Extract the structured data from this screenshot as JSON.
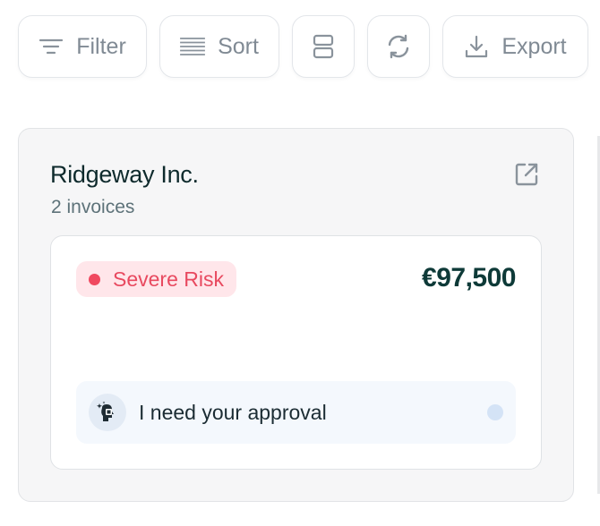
{
  "toolbar": {
    "filter_label": "Filter",
    "sort_label": "Sort",
    "export_label": "Export",
    "icons": [
      "filter-icon",
      "sort-lines-icon",
      "layout-rows-icon",
      "refresh-icon",
      "download-icon"
    ]
  },
  "card": {
    "company": "Ridgeway Inc.",
    "invoice_count": "2 invoices",
    "open_icon": "external-link-icon",
    "risk": {
      "label": "Severe Risk",
      "color": "#f0485f",
      "background": "#ffe6ea"
    },
    "amount": "€97,500",
    "approval": {
      "text": "I need your approval",
      "avatar_icon": "ai-agent-icon"
    }
  },
  "colors": {
    "text_primary": "#0e2a2c",
    "text_muted": "#5d7279",
    "toolbar_text": "#808a94",
    "card_bg": "#f6f6f7"
  }
}
